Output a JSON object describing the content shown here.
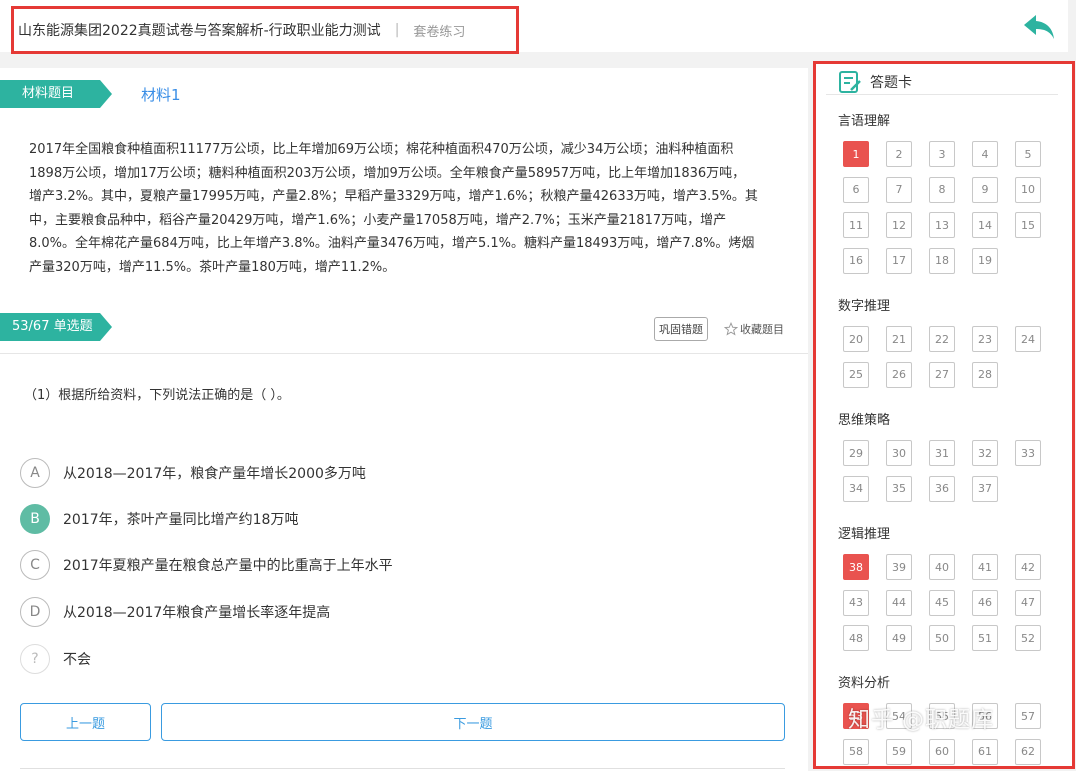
{
  "header": {
    "title": "山东能源集团2022真题试卷与答案解析-行政职业能力测试",
    "separator": "|",
    "mode": "套卷练习"
  },
  "material": {
    "tag": "材料题目",
    "link": "材料1",
    "lines": [
      "2017年全国粮食种植面积11177万公顷，比上年增加69万公顷；棉花种植面积470万公顷，减少34万公顷；油料种植面积",
      "1898万公顷，增加17万公顷；糖料种植面积203万公顷，增加9万公顷。全年粮食产量58957万吨，比上年增加1836万吨，",
      "增产3.2%。其中，夏粮产量17995万吨，产量2.8%；早稻产量3329万吨，增产1.6%；秋粮产量42633万吨，增产3.5%。其",
      "中，主要粮食品种中，稻谷产量20429万吨，增产1.6%；小麦产量17058万吨，增产2.7%；玉米产量21817万吨，增产",
      "8.0%。全年棉花产量684万吨，比上年增产3.8%。油料产量3476万吨，增产5.1%。糖料产量18493万吨，增产7.8%。烤烟",
      "产量320万吨，增产11.5%。茶叶产量180万吨，增产11.2%。"
    ]
  },
  "question": {
    "tag": "53/67 单选题",
    "consolidate_label": "巩固错题",
    "favorite_label": "收藏题目",
    "stem": "（1）根据所给资料，下列说法正确的是（  ）。",
    "options": [
      {
        "letter": "A",
        "text": "从2018—2017年，粮食产量年增长2000多万吨"
      },
      {
        "letter": "B",
        "text": "2017年，茶叶产量同比增产约18万吨"
      },
      {
        "letter": "C",
        "text": "2017年夏粮产量在粮食总产量中的比重高于上年水平"
      },
      {
        "letter": "D",
        "text": "从2018—2017年粮食产量增长率逐年提高"
      },
      {
        "letter": "?",
        "text": "不会"
      }
    ],
    "selected": "B",
    "prev_label": "上一题",
    "next_label": "下一题"
  },
  "answer_card": {
    "title": "答题卡",
    "sections": [
      {
        "name": "言语理解",
        "numbers": [
          1,
          2,
          3,
          4,
          5,
          6,
          7,
          8,
          9,
          10,
          11,
          12,
          13,
          14,
          15,
          16,
          17,
          18,
          19
        ]
      },
      {
        "name": "数字推理",
        "numbers": [
          20,
          21,
          22,
          23,
          24,
          25,
          26,
          27,
          28
        ]
      },
      {
        "name": "思维策略",
        "numbers": [
          29,
          30,
          31,
          32,
          33,
          34,
          35,
          36,
          37
        ]
      },
      {
        "name": "逻辑推理",
        "numbers": [
          38,
          39,
          40,
          41,
          42,
          43,
          44,
          45,
          46,
          47,
          48,
          49,
          50,
          51,
          52
        ]
      },
      {
        "name": "资料分析",
        "numbers": [
          53,
          54,
          55,
          56,
          57,
          58,
          59,
          60,
          61,
          62
        ]
      }
    ],
    "answered": [
      1,
      38,
      53
    ]
  },
  "watermark": "知乎 @职题库",
  "colors": {
    "accent_green": "#2db3a0",
    "answered_red": "#e9534f",
    "link_blue": "#3a9be0",
    "highlight_border": "#e53935"
  }
}
